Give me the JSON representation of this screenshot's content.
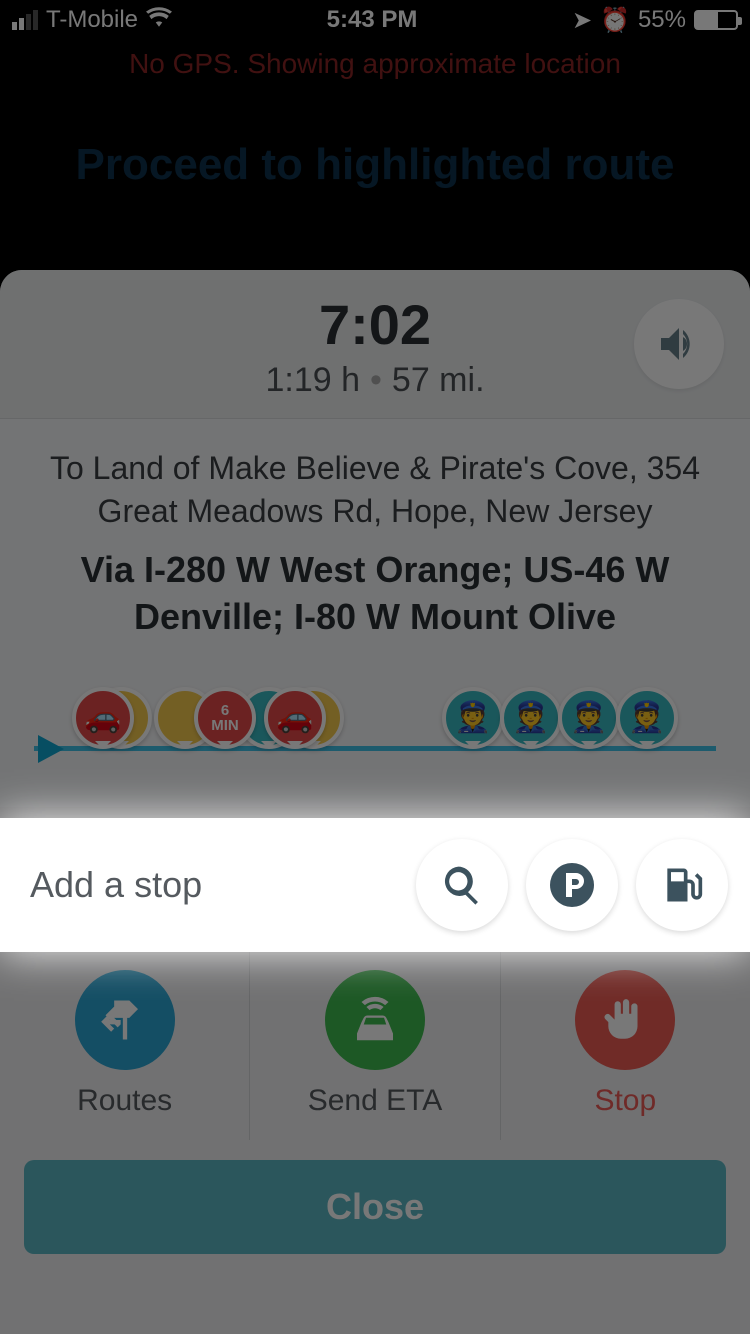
{
  "status": {
    "carrier": "T-Mobile",
    "time": "5:43 PM",
    "battery": "55%"
  },
  "gps_warning": "No GPS. Showing approximate location",
  "nav_instruction": "Proceed to highlighted route",
  "eta": {
    "arrival": "7:02",
    "duration": "1:19 h",
    "distance": "57 mi."
  },
  "destination": {
    "to": "To Land of Make Believe & Pirate's Cove, 354 Great Meadows Rd, Hope, New Jersey",
    "via": "Via I-280 W West Orange; US-46 W Denville; I-80 W Mount Olive"
  },
  "timeline_badge": {
    "value": "6",
    "unit": "MIN"
  },
  "add_stop": {
    "label": "Add a stop"
  },
  "actions": {
    "routes": "Routes",
    "send_eta": "Send ETA",
    "stop": "Stop"
  },
  "close": "Close"
}
